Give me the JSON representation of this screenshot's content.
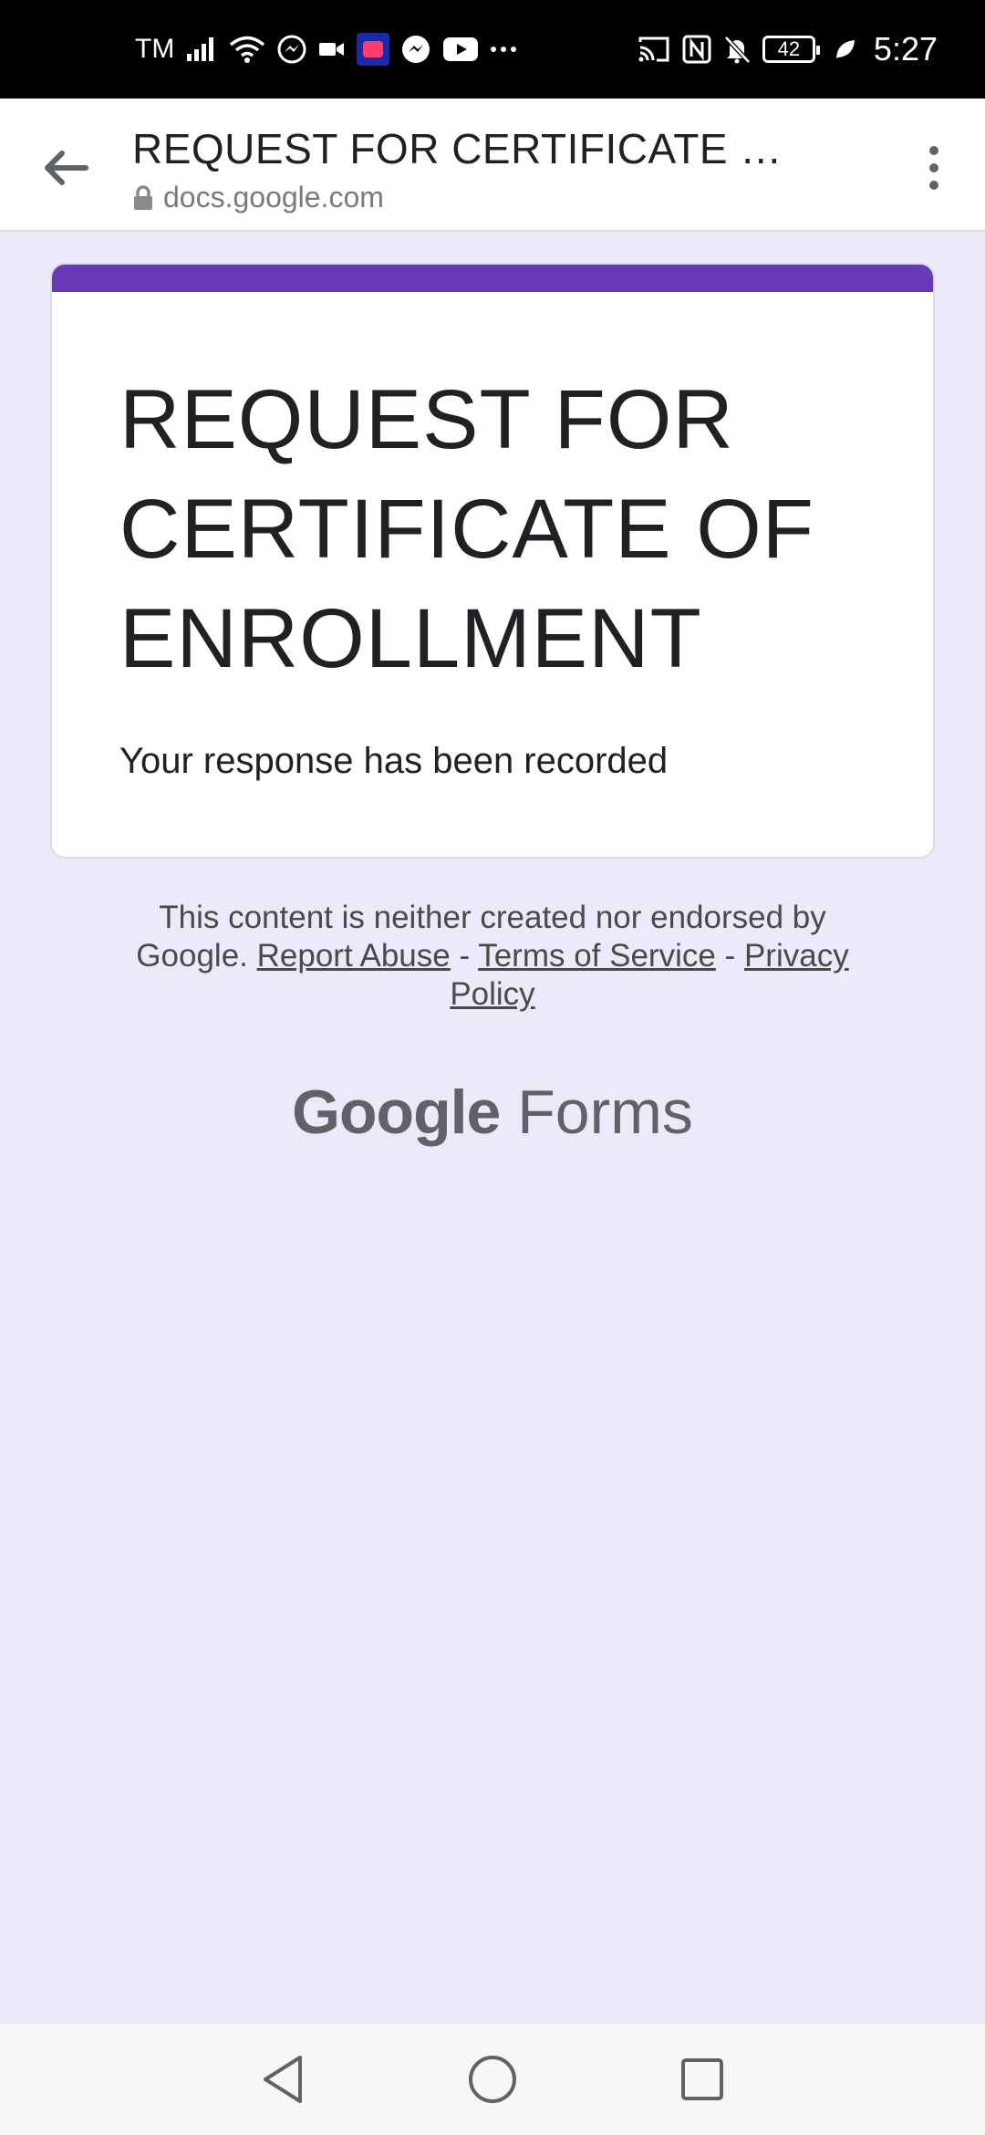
{
  "status_bar": {
    "carrier": "TM",
    "battery": "42",
    "time": "5:27"
  },
  "browser": {
    "page_title": "REQUEST FOR CERTIFICATE O...",
    "url": "docs.google.com"
  },
  "form": {
    "title": "REQUEST FOR CERTIFICATE OF ENROLLMENT",
    "message": "Your response has been recorded",
    "accent_color": "#673ab7"
  },
  "footer": {
    "notice_prefix": "This content is neither created nor endorsed by Google.",
    "report_abuse": "Report Abuse",
    "separator": "-",
    "terms": "Terms of Service",
    "privacy": "Privacy Policy"
  },
  "brand": {
    "google": "Google",
    "product": "Forms"
  }
}
